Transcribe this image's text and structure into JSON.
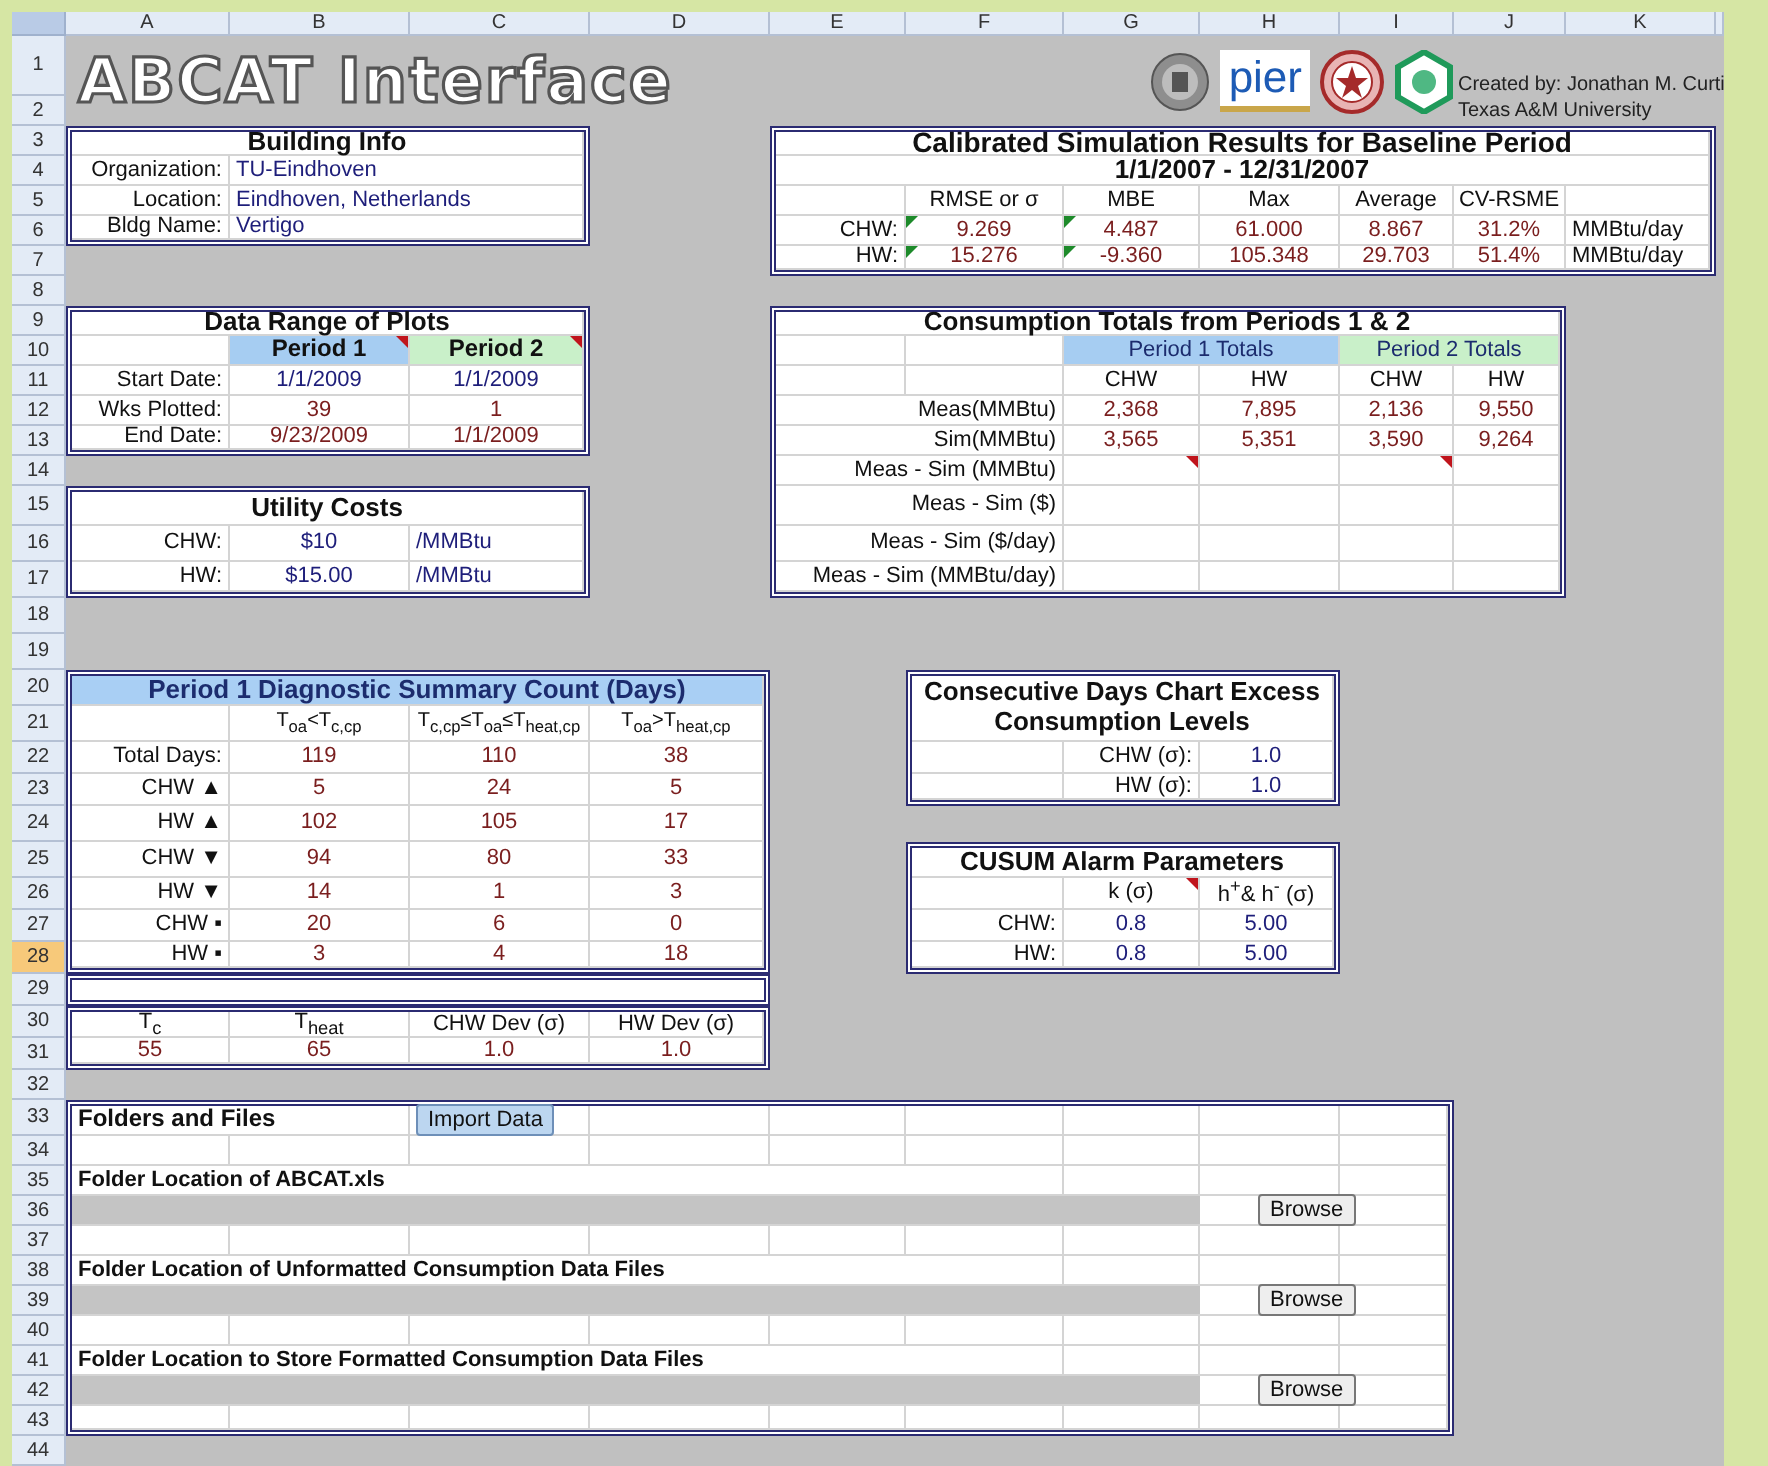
{
  "sheet": {
    "columns": [
      "A",
      "B",
      "C",
      "D",
      "E",
      "F",
      "G",
      "H",
      "I",
      "J",
      "K"
    ],
    "rows": [
      {
        "label": "1",
        "selected": false
      },
      {
        "label": "2",
        "selected": false
      },
      {
        "label": "3",
        "selected": false
      },
      {
        "label": "4",
        "selected": false
      },
      {
        "label": "5",
        "selected": false
      },
      {
        "label": "6",
        "selected": false
      },
      {
        "label": "7",
        "selected": false
      },
      {
        "label": "8",
        "selected": false
      },
      {
        "label": "9",
        "selected": false
      },
      {
        "label": "10",
        "selected": false
      },
      {
        "label": "11",
        "selected": false
      },
      {
        "label": "12",
        "selected": false
      },
      {
        "label": "13",
        "selected": false
      },
      {
        "label": "14",
        "selected": false
      },
      {
        "label": "15",
        "selected": false
      },
      {
        "label": "16",
        "selected": false
      },
      {
        "label": "17",
        "selected": false
      },
      {
        "label": "18",
        "selected": false
      },
      {
        "label": "19",
        "selected": false
      },
      {
        "label": "20",
        "selected": false
      },
      {
        "label": "21",
        "selected": false
      },
      {
        "label": "22",
        "selected": false
      },
      {
        "label": "23",
        "selected": false
      },
      {
        "label": "24",
        "selected": false
      },
      {
        "label": "25",
        "selected": false
      },
      {
        "label": "26",
        "selected": false
      },
      {
        "label": "27",
        "selected": false
      },
      {
        "label": "28",
        "selected": true
      },
      {
        "label": "29",
        "selected": false
      },
      {
        "label": "30",
        "selected": false
      },
      {
        "label": "31",
        "selected": false
      },
      {
        "label": "32",
        "selected": false
      },
      {
        "label": "33",
        "selected": false
      },
      {
        "label": "34",
        "selected": false
      },
      {
        "label": "35",
        "selected": false
      },
      {
        "label": "36",
        "selected": false
      },
      {
        "label": "37",
        "selected": false
      },
      {
        "label": "38",
        "selected": false
      },
      {
        "label": "39",
        "selected": false
      },
      {
        "label": "40",
        "selected": false
      },
      {
        "label": "41",
        "selected": false
      },
      {
        "label": "42",
        "selected": false
      },
      {
        "label": "43",
        "selected": false
      },
      {
        "label": "44",
        "selected": false
      }
    ]
  },
  "title": "ABCAT Interface",
  "logos": [
    {
      "kind": "seal"
    },
    {
      "kind": "wordmark",
      "text": "pier"
    },
    {
      "kind": "star-seal"
    },
    {
      "kind": "hexagon"
    }
  ],
  "credits": [
    "Created by: Jonathan M. Curti",
    "Texas A&M University"
  ],
  "building_info": {
    "title": "Building Info",
    "rows": [
      {
        "label": "Organization:",
        "value": "TU-Eindhoven"
      },
      {
        "label": "Location:",
        "value": "Eindhoven, Netherlands"
      },
      {
        "label": "Bldg Name:",
        "value": "Vertigo"
      }
    ]
  },
  "simulation_results": {
    "title": "Calibrated Simulation Results for Baseline Period",
    "period": "1/1/2007 - 12/31/2007",
    "columns": [
      "RMSE or σ",
      "MBE",
      "Max",
      "Average",
      "CV-RSME"
    ],
    "rows": [
      {
        "label": "CHW:",
        "values": [
          {
            "text": "9.269",
            "flag": true
          },
          {
            "text": "4.487",
            "flag": true
          },
          {
            "text": "61.000",
            "flag": false
          },
          {
            "text": "8.867",
            "flag": false
          },
          {
            "text": "31.2%",
            "flag": false
          }
        ],
        "unit": "MMBtu/day"
      },
      {
        "label": "HW:",
        "values": [
          {
            "text": "15.276",
            "flag": true
          },
          {
            "text": "-9.360",
            "flag": true
          },
          {
            "text": "105.348",
            "flag": false
          },
          {
            "text": "29.703",
            "flag": false
          },
          {
            "text": "51.4%",
            "flag": false
          }
        ],
        "unit": "MMBtu/day"
      }
    ]
  },
  "data_range": {
    "title": "Data Range of Plots",
    "periods": [
      {
        "label": "Period 1",
        "color": "#a6cdf2",
        "note": true
      },
      {
        "label": "Period 2",
        "color": "#c9f0c9",
        "note": true
      }
    ],
    "rows": [
      {
        "label": "Start Date:",
        "values": [
          "1/1/2009",
          "1/1/2009"
        ]
      },
      {
        "label": "Wks Plotted:",
        "values": [
          "39",
          "1"
        ]
      },
      {
        "label": "End Date:",
        "values": [
          "9/23/2009",
          "1/1/2009"
        ]
      }
    ]
  },
  "utility_costs": {
    "title": "Utility Costs",
    "rows": [
      {
        "label": "CHW:",
        "value": "$10",
        "unit": "/MMBtu"
      },
      {
        "label": "HW:",
        "value": "$15.00",
        "unit": "/MMBtu"
      }
    ]
  },
  "consumption_totals": {
    "title": "Consumption Totals from Periods 1 & 2",
    "groups": [
      {
        "label": "Period 1 Totals",
        "color": "#a6cdf2"
      },
      {
        "label": "Period 2 Totals",
        "color": "#c9f0c9"
      }
    ],
    "columns": [
      "CHW",
      "HW",
      "CHW",
      "HW"
    ],
    "rows": [
      {
        "label": "Meas(MMBtu)",
        "cells": [
          {
            "text": "2,368",
            "note": false
          },
          {
            "text": "7,895",
            "note": false
          },
          {
            "text": "2,136",
            "note": false
          },
          {
            "text": "9,550",
            "note": false
          }
        ]
      },
      {
        "label": "Sim(MMBtu)",
        "cells": [
          {
            "text": "3,565",
            "note": false
          },
          {
            "text": "5,351",
            "note": false
          },
          {
            "text": "3,590",
            "note": false
          },
          {
            "text": "9,264",
            "note": false
          }
        ]
      },
      {
        "label": "Meas - Sim (MMBtu)",
        "cells": [
          {
            "note": true
          },
          {
            "note": false
          },
          {
            "note": true
          },
          {
            "note": false
          }
        ]
      },
      {
        "label": "Meas - Sim ($)",
        "cells": [
          {
            "note": false
          },
          {
            "note": false
          },
          {
            "note": false
          },
          {
            "note": false
          }
        ]
      },
      {
        "label": "Meas - Sim ($/day)",
        "cells": [
          {
            "note": false
          },
          {
            "note": false
          },
          {
            "note": false
          },
          {
            "note": false
          }
        ]
      },
      {
        "label": "Meas - Sim (MMBtu/day)",
        "cells": [
          {
            "note": false
          },
          {
            "note": false
          },
          {
            "note": false
          },
          {
            "note": false
          }
        ]
      }
    ]
  },
  "diagnostic_summary": {
    "title": "Period 1 Diagnostic Summary Count (Days)",
    "columns": [
      "T$_{oa}$<T$_{c,cp}$",
      "T$_{c,cp}$≤T$_{oa}$≤T$_{heat,cp}$",
      "T$_{oa}$>T$_{heat,cp}$"
    ],
    "rows": [
      {
        "label": "Total Days:",
        "values": [
          "119",
          "110",
          "38"
        ]
      },
      {
        "label": "CHW ▲",
        "values": [
          "5",
          "24",
          "5"
        ]
      },
      {
        "label": "HW ▲",
        "values": [
          "102",
          "105",
          "17"
        ]
      },
      {
        "label": "CHW ▼",
        "values": [
          "94",
          "80",
          "33"
        ]
      },
      {
        "label": "HW ▼",
        "values": [
          "14",
          "1",
          "3"
        ]
      },
      {
        "label": "CHW ▪",
        "values": [
          "20",
          "6",
          "0"
        ]
      },
      {
        "label": "HW ▪",
        "values": [
          "3",
          "4",
          "18"
        ]
      }
    ]
  },
  "diagnostic_parameters": {
    "columns": [
      "T$_{c}$",
      "T$_{heat}$",
      "CHW Dev (σ)",
      "HW Dev (σ)"
    ],
    "values": [
      "55",
      "65",
      "1.0",
      "1.0"
    ]
  },
  "consecutive_days": {
    "title": "Consecutive Days Chart Excess Consumption Levels",
    "rows": [
      {
        "label": "CHW (σ):",
        "value": "1.0"
      },
      {
        "label": "HW (σ):",
        "value": "1.0"
      }
    ]
  },
  "cusum": {
    "title": "CUSUM Alarm Parameters",
    "columns": [
      {
        "text": "k (σ)",
        "note": true
      },
      {
        "text": "h$^{+}$& h$^{-}$ (σ)",
        "note": false
      }
    ],
    "rows": [
      {
        "label": "CHW:",
        "values": [
          "0.8",
          "5.00"
        ]
      },
      {
        "label": "HW:",
        "values": [
          "0.8",
          "5.00"
        ]
      }
    ]
  },
  "folders": {
    "title": "Folders and Files",
    "import_button": "Import Data",
    "locations": [
      {
        "label": "Folder Location of ABCAT.xls",
        "button": "Browse"
      },
      {
        "label": "Folder Location of Unformatted Consumption Data Files",
        "button": "Browse"
      },
      {
        "label": "Folder Location to Store Formatted Consumption Data Files",
        "button": "Browse"
      }
    ]
  }
}
